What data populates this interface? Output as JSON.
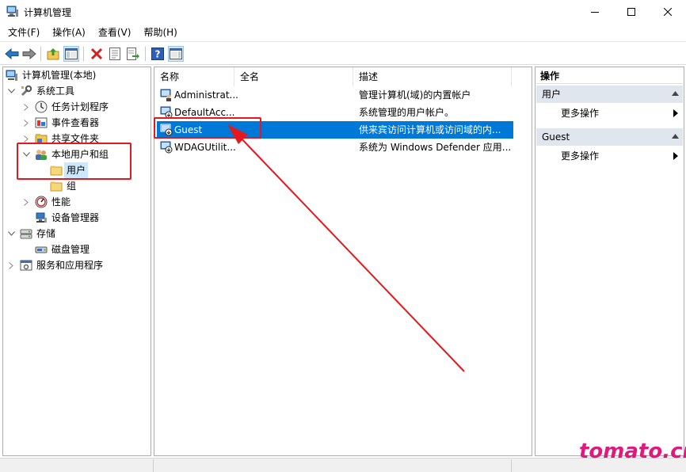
{
  "window": {
    "title": "计算机管理",
    "app_icon": "computer-management-icon"
  },
  "menu": [
    "文件(F)",
    "操作(A)",
    "查看(V)",
    "帮助(H)"
  ],
  "toolbar_icons": [
    "back-arrow-icon",
    "forward-arrow-icon",
    "up-folder-icon",
    "show-hide-tree-icon",
    "delete-icon",
    "properties-icon",
    "export-list-icon",
    "help-icon",
    "show-hide-action-pane-icon"
  ],
  "tree": {
    "root": "计算机管理(本地)",
    "system_tools": "系统工具",
    "task_scheduler": "任务计划程序",
    "event_viewer": "事件查看器",
    "shared_folders": "共享文件夹",
    "local_users_groups": "本地用户和组",
    "users": "用户",
    "groups": "组",
    "performance": "性能",
    "device_manager": "设备管理器",
    "storage": "存储",
    "disk_management": "磁盘管理",
    "services_apps": "服务和应用程序"
  },
  "list": {
    "columns": [
      "名称",
      "全名",
      "描述"
    ],
    "rows": [
      {
        "name": "Administrat...",
        "fullname": "",
        "desc": "管理计算机(域)的内置帐户"
      },
      {
        "name": "DefaultAcc...",
        "fullname": "",
        "desc": "系统管理的用户帐户。"
      },
      {
        "name": "Guest",
        "fullname": "",
        "desc": "供来宾访问计算机或访问域的内..."
      },
      {
        "name": "WDAGUtilit...",
        "fullname": "",
        "desc": "系统为 Windows Defender 应用..."
      }
    ]
  },
  "actions": {
    "title": "操作",
    "section1": "用户",
    "section1_item": "更多操作",
    "section2": "Guest",
    "section2_item": "更多操作"
  },
  "watermark": "tomato.cm",
  "colors": {
    "selection": "#0078d7",
    "annotation_red": "#e5191d",
    "watermark": "#e0197d"
  }
}
